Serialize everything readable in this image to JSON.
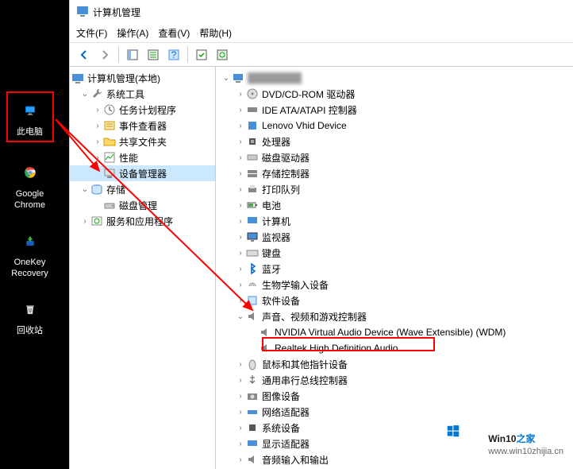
{
  "desktop": {
    "this_pc": "此电脑",
    "chrome": "Google\nChrome",
    "onekey": "OneKey\nRecovery",
    "recycle": "回收站"
  },
  "window": {
    "title": "计算机管理",
    "menu": {
      "file": "文件(F)",
      "action": "操作(A)",
      "view": "查看(V)",
      "help": "帮助(H)"
    }
  },
  "left": {
    "root": "计算机管理(本地)",
    "sys_tools": "系统工具",
    "task_sched": "任务计划程序",
    "event_viewer": "事件查看器",
    "shared": "共享文件夹",
    "perf": "性能",
    "devmgr": "设备管理器",
    "storage": "存储",
    "diskmgmt": "磁盘管理",
    "services": "服务和应用程序"
  },
  "right": {
    "dvd": "DVD/CD-ROM 驱动器",
    "ide": "IDE ATA/ATAPI 控制器",
    "lenovo": "Lenovo Vhid Device",
    "cpu": "处理器",
    "disk": "磁盘驱动器",
    "storectrl": "存储控制器",
    "printq": "打印队列",
    "battery": "电池",
    "computer": "计算机",
    "monitor": "监视器",
    "keyboard": "键盘",
    "bluetooth": "蓝牙",
    "biometric": "生物学输入设备",
    "software": "软件设备",
    "sound": "声音、视频和游戏控制器",
    "nvidia": "NVIDIA Virtual Audio Device (Wave Extensible) (WDM)",
    "realtek": "Realtek High Definition Audio",
    "mouse": "鼠标和其他指针设备",
    "usb": "通用串行总线控制器",
    "imaging": "图像设备",
    "netadapter": "网络适配器",
    "sysdev": "系统设备",
    "display": "显示适配器",
    "audioio": "音频输入和输出"
  },
  "watermark": {
    "brand": "Win10",
    "suffix": "之家",
    "url": "www.win10zhijia.cn"
  }
}
